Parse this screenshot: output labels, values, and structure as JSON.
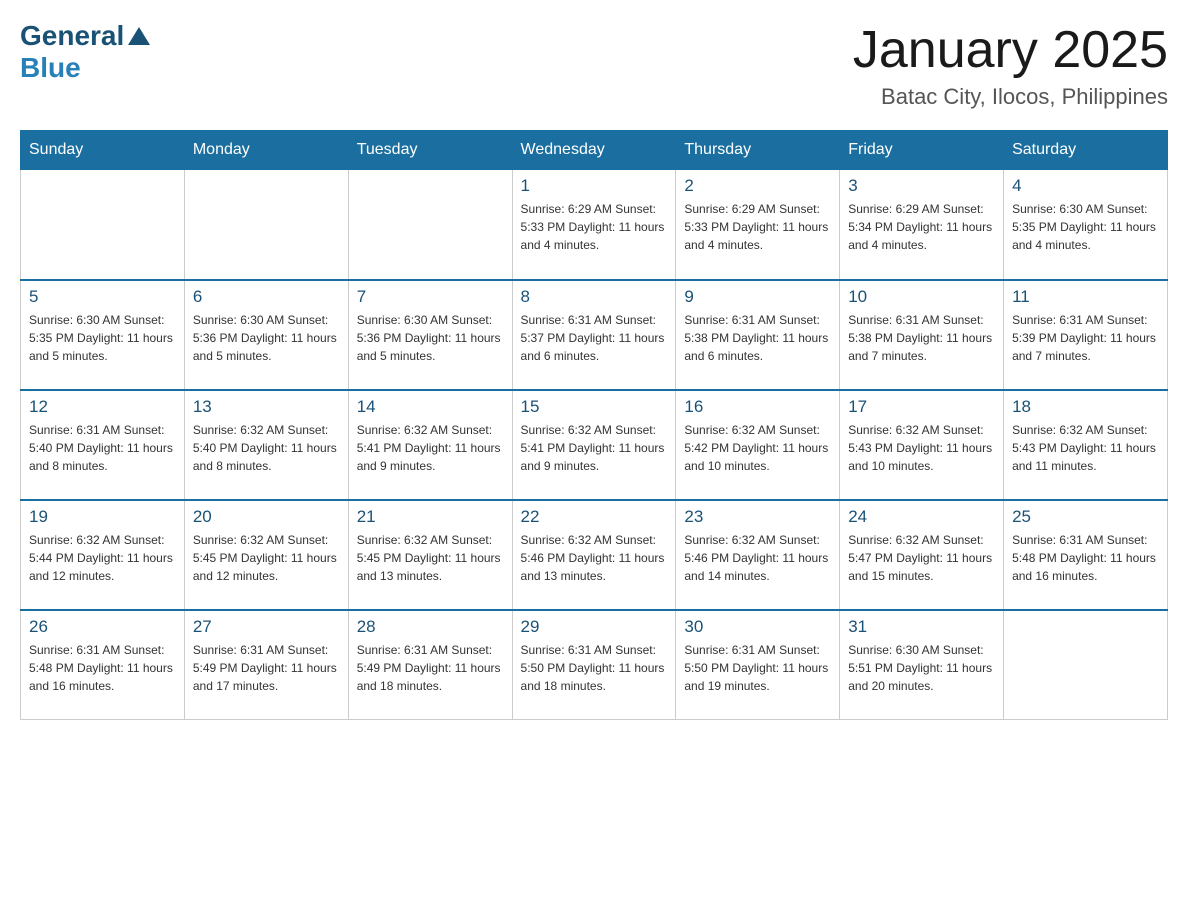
{
  "header": {
    "logo_general": "General",
    "logo_blue": "Blue",
    "month_title": "January 2025",
    "location": "Batac City, Ilocos, Philippines"
  },
  "days_of_week": [
    "Sunday",
    "Monday",
    "Tuesday",
    "Wednesday",
    "Thursday",
    "Friday",
    "Saturday"
  ],
  "weeks": [
    [
      {
        "day": "",
        "info": ""
      },
      {
        "day": "",
        "info": ""
      },
      {
        "day": "",
        "info": ""
      },
      {
        "day": "1",
        "info": "Sunrise: 6:29 AM\nSunset: 5:33 PM\nDaylight: 11 hours\nand 4 minutes."
      },
      {
        "day": "2",
        "info": "Sunrise: 6:29 AM\nSunset: 5:33 PM\nDaylight: 11 hours\nand 4 minutes."
      },
      {
        "day": "3",
        "info": "Sunrise: 6:29 AM\nSunset: 5:34 PM\nDaylight: 11 hours\nand 4 minutes."
      },
      {
        "day": "4",
        "info": "Sunrise: 6:30 AM\nSunset: 5:35 PM\nDaylight: 11 hours\nand 4 minutes."
      }
    ],
    [
      {
        "day": "5",
        "info": "Sunrise: 6:30 AM\nSunset: 5:35 PM\nDaylight: 11 hours\nand 5 minutes."
      },
      {
        "day": "6",
        "info": "Sunrise: 6:30 AM\nSunset: 5:36 PM\nDaylight: 11 hours\nand 5 minutes."
      },
      {
        "day": "7",
        "info": "Sunrise: 6:30 AM\nSunset: 5:36 PM\nDaylight: 11 hours\nand 5 minutes."
      },
      {
        "day": "8",
        "info": "Sunrise: 6:31 AM\nSunset: 5:37 PM\nDaylight: 11 hours\nand 6 minutes."
      },
      {
        "day": "9",
        "info": "Sunrise: 6:31 AM\nSunset: 5:38 PM\nDaylight: 11 hours\nand 6 minutes."
      },
      {
        "day": "10",
        "info": "Sunrise: 6:31 AM\nSunset: 5:38 PM\nDaylight: 11 hours\nand 7 minutes."
      },
      {
        "day": "11",
        "info": "Sunrise: 6:31 AM\nSunset: 5:39 PM\nDaylight: 11 hours\nand 7 minutes."
      }
    ],
    [
      {
        "day": "12",
        "info": "Sunrise: 6:31 AM\nSunset: 5:40 PM\nDaylight: 11 hours\nand 8 minutes."
      },
      {
        "day": "13",
        "info": "Sunrise: 6:32 AM\nSunset: 5:40 PM\nDaylight: 11 hours\nand 8 minutes."
      },
      {
        "day": "14",
        "info": "Sunrise: 6:32 AM\nSunset: 5:41 PM\nDaylight: 11 hours\nand 9 minutes."
      },
      {
        "day": "15",
        "info": "Sunrise: 6:32 AM\nSunset: 5:41 PM\nDaylight: 11 hours\nand 9 minutes."
      },
      {
        "day": "16",
        "info": "Sunrise: 6:32 AM\nSunset: 5:42 PM\nDaylight: 11 hours\nand 10 minutes."
      },
      {
        "day": "17",
        "info": "Sunrise: 6:32 AM\nSunset: 5:43 PM\nDaylight: 11 hours\nand 10 minutes."
      },
      {
        "day": "18",
        "info": "Sunrise: 6:32 AM\nSunset: 5:43 PM\nDaylight: 11 hours\nand 11 minutes."
      }
    ],
    [
      {
        "day": "19",
        "info": "Sunrise: 6:32 AM\nSunset: 5:44 PM\nDaylight: 11 hours\nand 12 minutes."
      },
      {
        "day": "20",
        "info": "Sunrise: 6:32 AM\nSunset: 5:45 PM\nDaylight: 11 hours\nand 12 minutes."
      },
      {
        "day": "21",
        "info": "Sunrise: 6:32 AM\nSunset: 5:45 PM\nDaylight: 11 hours\nand 13 minutes."
      },
      {
        "day": "22",
        "info": "Sunrise: 6:32 AM\nSunset: 5:46 PM\nDaylight: 11 hours\nand 13 minutes."
      },
      {
        "day": "23",
        "info": "Sunrise: 6:32 AM\nSunset: 5:46 PM\nDaylight: 11 hours\nand 14 minutes."
      },
      {
        "day": "24",
        "info": "Sunrise: 6:32 AM\nSunset: 5:47 PM\nDaylight: 11 hours\nand 15 minutes."
      },
      {
        "day": "25",
        "info": "Sunrise: 6:31 AM\nSunset: 5:48 PM\nDaylight: 11 hours\nand 16 minutes."
      }
    ],
    [
      {
        "day": "26",
        "info": "Sunrise: 6:31 AM\nSunset: 5:48 PM\nDaylight: 11 hours\nand 16 minutes."
      },
      {
        "day": "27",
        "info": "Sunrise: 6:31 AM\nSunset: 5:49 PM\nDaylight: 11 hours\nand 17 minutes."
      },
      {
        "day": "28",
        "info": "Sunrise: 6:31 AM\nSunset: 5:49 PM\nDaylight: 11 hours\nand 18 minutes."
      },
      {
        "day": "29",
        "info": "Sunrise: 6:31 AM\nSunset: 5:50 PM\nDaylight: 11 hours\nand 18 minutes."
      },
      {
        "day": "30",
        "info": "Sunrise: 6:31 AM\nSunset: 5:50 PM\nDaylight: 11 hours\nand 19 minutes."
      },
      {
        "day": "31",
        "info": "Sunrise: 6:30 AM\nSunset: 5:51 PM\nDaylight: 11 hours\nand 20 minutes."
      },
      {
        "day": "",
        "info": ""
      }
    ]
  ]
}
